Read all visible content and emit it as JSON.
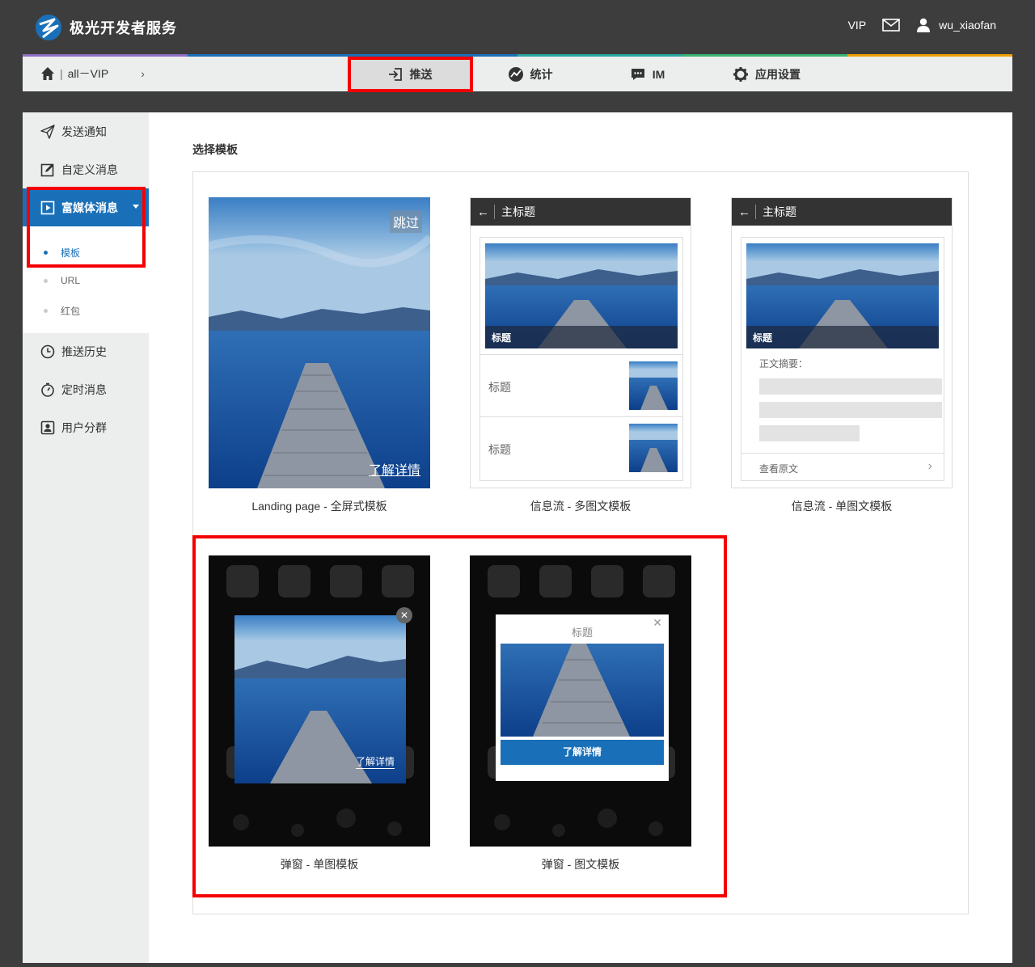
{
  "header": {
    "brand": "极光开发者服务",
    "vip_label": "VIP",
    "username": "wu_xiaofan"
  },
  "navbar": {
    "breadcrumb_app": "all－VIP",
    "tabs": [
      {
        "label": "推送",
        "icon": "push-icon"
      },
      {
        "label": "统计",
        "icon": "stats-icon"
      },
      {
        "label": "IM",
        "icon": "chat-icon"
      },
      {
        "label": "应用设置",
        "icon": "gear-icon"
      }
    ],
    "stripe_colors": [
      "#8e6fc4",
      "#1a70b8",
      "#1a70b8",
      "#2aa7a0",
      "#3cb371",
      "#f0a000"
    ]
  },
  "sidebar": {
    "items": [
      {
        "label": "发送通知",
        "icon": "send-icon"
      },
      {
        "label": "自定义消息",
        "icon": "edit-icon"
      },
      {
        "label": "富媒体消息",
        "icon": "media-icon"
      },
      {
        "label": "推送历史",
        "icon": "clock-icon"
      },
      {
        "label": "定时消息",
        "icon": "timer-icon"
      },
      {
        "label": "用户分群",
        "icon": "user-group-icon"
      }
    ],
    "sub_items": [
      {
        "label": "模板"
      },
      {
        "label": "URL"
      },
      {
        "label": "红包"
      }
    ]
  },
  "main": {
    "section_title": "选择模板",
    "templates": [
      {
        "caption": "Landing page - 全屏式模板",
        "skip_label": "跳过",
        "more_label": "了解详情"
      },
      {
        "caption": "信息流 - 多图文模板",
        "header_title": "主标题",
        "hero_title": "标题",
        "row1_title": "标题",
        "row2_title": "标题"
      },
      {
        "caption": "信息流 - 单图文模板",
        "header_title": "主标题",
        "hero_title": "标题",
        "summary_label": "正文摘要：",
        "read_more": "查看原文"
      },
      {
        "caption": "弹窗 - 单图模板",
        "more_label": "了解详情"
      },
      {
        "caption": "弹窗 - 图文模板",
        "popup_title": "标题",
        "button_label": "了解详情"
      }
    ]
  },
  "colors": {
    "page_bg": "#3d3d3d",
    "accent": "#1a70b8",
    "highlight": "#f40000"
  }
}
